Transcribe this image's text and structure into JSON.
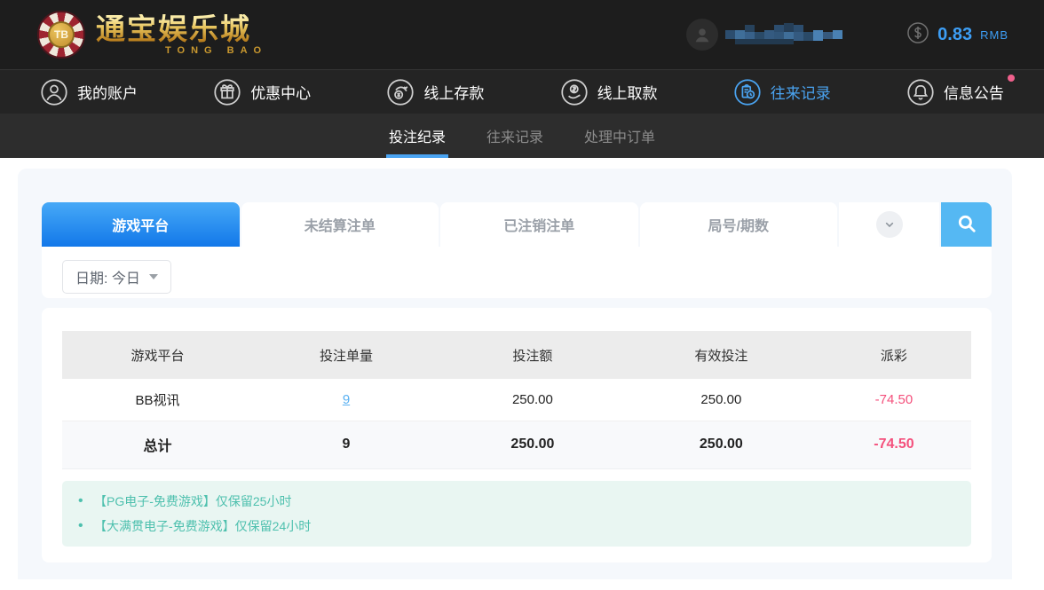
{
  "header": {
    "logo": {
      "monogram": "TB",
      "title": "通宝娱乐城",
      "subtitle": "TONG BAO"
    },
    "balance": {
      "amount": "0.83",
      "currency": "RMB"
    }
  },
  "nav": {
    "items": [
      {
        "label": "我的账户",
        "icon": "user-icon",
        "active": false
      },
      {
        "label": "优惠中心",
        "icon": "gift-icon",
        "active": false
      },
      {
        "label": "线上存款",
        "icon": "deposit-icon",
        "active": false
      },
      {
        "label": "线上取款",
        "icon": "withdraw-icon",
        "active": false
      },
      {
        "label": "往来记录",
        "icon": "records-icon",
        "active": true
      },
      {
        "label": "信息公告",
        "icon": "bell-icon",
        "active": false,
        "has_notification_dot": true
      }
    ]
  },
  "subnav": {
    "tabs": [
      {
        "label": "投注纪录",
        "active": true
      },
      {
        "label": "往来记录",
        "active": false
      },
      {
        "label": "处理中订单",
        "active": false
      }
    ]
  },
  "filters": {
    "tabs": [
      {
        "label": "游戏平台",
        "active": true
      },
      {
        "label": "未结算注单",
        "active": false
      },
      {
        "label": "已注销注单",
        "active": false
      },
      {
        "label": "局号/期数",
        "active": false
      }
    ],
    "date_label": "日期: 今日"
  },
  "table": {
    "headers": [
      "游戏平台",
      "投注单量",
      "投注额",
      "有效投注",
      "派彩"
    ],
    "rows": [
      {
        "platform": "BB视讯",
        "count": "9",
        "bet": "250.00",
        "valid": "250.00",
        "payout": "-74.50"
      }
    ],
    "total": {
      "label": "总计",
      "count": "9",
      "bet": "250.00",
      "valid": "250.00",
      "payout": "-74.50"
    }
  },
  "notes": [
    "【PG电子-免费游戏】仅保留25小时",
    "【大满贯电子-免费游戏】仅保留24小时"
  ],
  "colors": {
    "accent_blue": "#3d9ef5",
    "tab_gradient_top": "#47a9f7",
    "tab_gradient_bottom": "#1278e9",
    "search_button": "#55b8f3",
    "link_blue": "#58b0f2",
    "negative_red": "#f4507c",
    "note_teal": "#4ec0ae",
    "note_bg": "#e9f6f2",
    "logo_gold": "#d9a43b",
    "notification_dot": "#f0608c"
  }
}
